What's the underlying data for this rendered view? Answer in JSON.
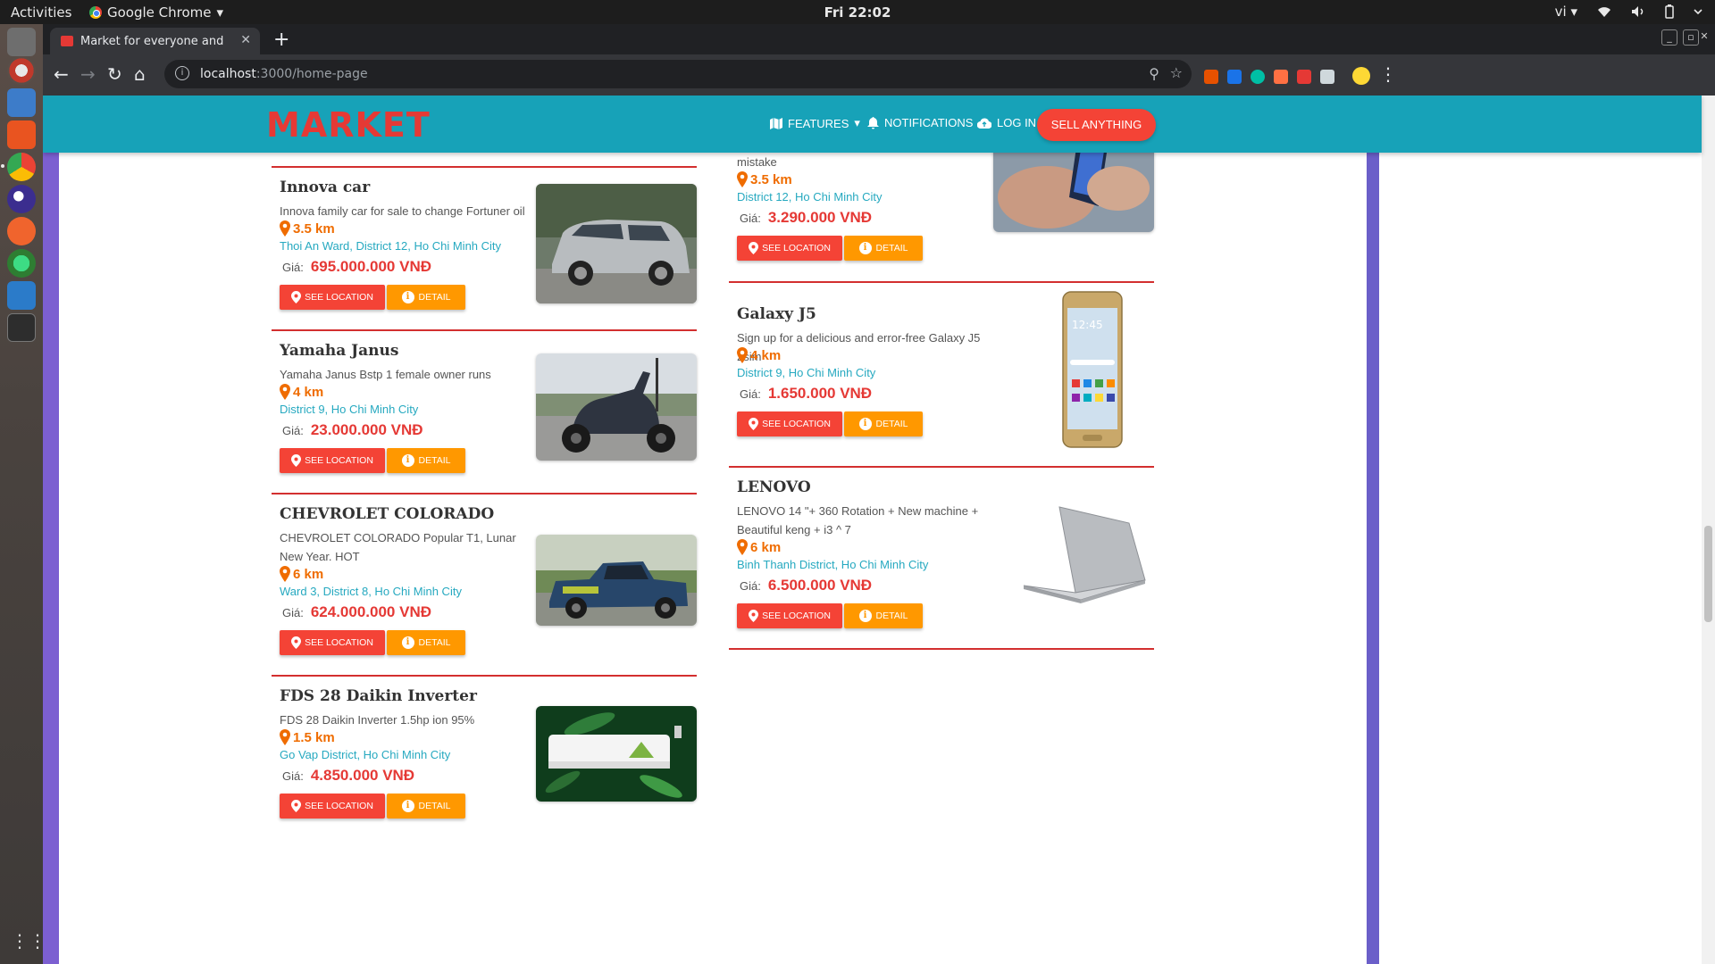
{
  "os": {
    "activities": "Activities",
    "app_name": "Google Chrome",
    "app_menu_arrow": "▾",
    "clock": "Fri 22:02",
    "input_method": "vi ▾"
  },
  "browser": {
    "tab_title": "Market for everyone and",
    "tab_close": "✕",
    "new_tab": "+",
    "url_host": "localhost",
    "url_path": ":3000/home-page"
  },
  "site": {
    "brand": "MARKET",
    "nav": {
      "features": "FEATURES",
      "notifications": "NOTIFICATIONS",
      "login": "LOG IN",
      "sell": "SELL ANYTHING"
    }
  },
  "labels": {
    "price_prefix": "Giá:",
    "see_location": "SEE LOCATION",
    "detail": "DETAIL"
  },
  "listings_left": [
    {
      "title": "Innova car",
      "description": "Innova family car for sale to change Fortuner oil",
      "distance": "3.5 km",
      "address": "Thoi An Ward, District 12, Ho Chi Minh City",
      "price": "695.000.000 VNĐ"
    },
    {
      "title": "Yamaha Janus",
      "description": "Yamaha Janus Bstp 1 female owner runs",
      "distance": "4 km",
      "address": "District 9, Ho Chi Minh City",
      "price": "23.000.000 VNĐ"
    },
    {
      "title": "CHEVROLET COLORADO",
      "description": "CHEVROLET COLORADO Popular T1, Lunar New Year. HOT",
      "distance": "6 km",
      "address": "Ward 3, District 8, Ho Chi Minh City",
      "price": "624.000.000 VNĐ"
    },
    {
      "title": "FDS 28 Daikin Inverter",
      "description": "FDS 28 Daikin Inverter 1.5hp ion 95%",
      "distance": "1.5 km",
      "address": "Go Vap District, Ho Chi Minh City",
      "price": "4.850.000 VNĐ"
    }
  ],
  "listings_right": [
    {
      "title": "",
      "description": "mistake",
      "distance": "3.5 km",
      "address": "District 12, Ho Chi Minh City",
      "price": "3.290.000 VNĐ"
    },
    {
      "title": "Galaxy J5",
      "description": "Sign up for a delicious and error-free Galaxy J5 2sim",
      "distance": "4 km",
      "address": "District 9, Ho Chi Minh City",
      "price": "1.650.000 VNĐ",
      "phone_clock": "12:45"
    },
    {
      "title": "LENOVO",
      "description": "LENOVO 14 \"+ 360 Rotation + New machine + Beautiful keng + i3 ^ 7",
      "distance": "6 km",
      "address": "Binh Thanh District, Ho Chi Minh City",
      "price": "6.500.000 VNĐ"
    }
  ]
}
